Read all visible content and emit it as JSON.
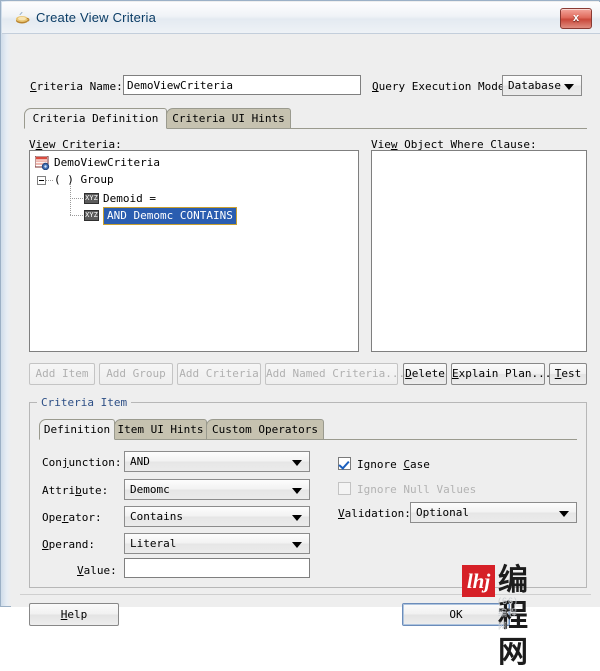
{
  "window": {
    "title": "Create View Criteria",
    "app_icon": "java-cup-icon",
    "close_label": "x"
  },
  "header": {
    "criteria_name_label": "Criteria Name:",
    "criteria_name_value": "DemoViewCriteria",
    "query_execution_mode_label": "Query Execution Mode:",
    "query_execution_mode_value": "Database"
  },
  "main_tabs": [
    {
      "label": "Criteria Definition",
      "selected": true
    },
    {
      "label": "Criteria UI Hints",
      "selected": false
    }
  ],
  "view_criteria": {
    "label": "View Criteria:",
    "nodes": [
      {
        "text": "DemoViewCriteria",
        "icon": "view-criteria-icon",
        "level": 0,
        "selected": false
      },
      {
        "text": "( ) Group",
        "icon": "group-icon",
        "level": 1,
        "selected": false
      },
      {
        "text": "Demoid =",
        "icon": "xyz-icon",
        "level": 2,
        "selected": false
      },
      {
        "text": "AND Demomc CONTAINS",
        "icon": "xyz-icon",
        "level": 2,
        "selected": true
      }
    ]
  },
  "where_clause": {
    "label": "View Object Where Clause:",
    "value": ""
  },
  "action_buttons": [
    {
      "label": "Add Item",
      "enabled": false
    },
    {
      "label": "Add Group",
      "enabled": false
    },
    {
      "label": "Add Criteria",
      "enabled": false
    },
    {
      "label": "Add Named Criteria...",
      "enabled": false
    },
    {
      "label": "Delete",
      "enabled": true
    },
    {
      "label": "Explain Plan...",
      "enabled": true
    },
    {
      "label": "Test",
      "enabled": true
    }
  ],
  "criteria_item": {
    "group_title": "Criteria Item",
    "tabs": [
      {
        "label": "Definition",
        "selected": true
      },
      {
        "label": "Item UI Hints",
        "selected": false
      },
      {
        "label": "Custom Operators",
        "selected": false
      }
    ],
    "fields": {
      "conjunction_label": "Conjunction:",
      "conjunction_value": "AND",
      "attribute_label": "Attribute:",
      "attribute_value": "Demomc",
      "operator_label": "Operator:",
      "operator_value": "Contains",
      "operand_label": "Operand:",
      "operand_value": "Literal",
      "value_label": "Value:",
      "value_value": ""
    },
    "options": {
      "ignore_case_label": "Ignore Case",
      "ignore_case_checked": true,
      "ignore_case_enabled": true,
      "ignore_null_label": "Ignore Null Values",
      "ignore_null_checked": false,
      "ignore_null_enabled": false,
      "validation_label": "Validation:",
      "validation_value": "Optional"
    }
  },
  "footer": {
    "help_label": "Help",
    "ok_label": "OK"
  },
  "watermark": {
    "logo_text": "lhj",
    "brand_text": "编程网",
    "sub_text": "(66)编程网",
    "logo_color": "#d62027"
  }
}
